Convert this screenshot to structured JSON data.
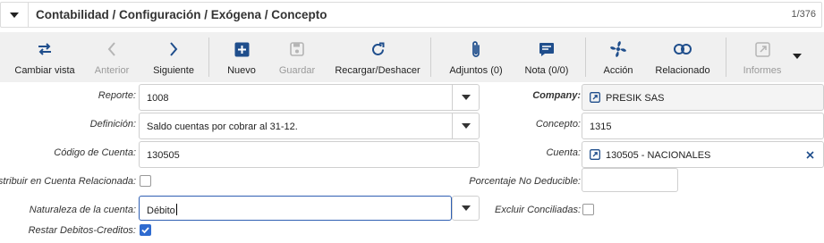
{
  "header": {
    "title": "Contabilidad / Configuración / Exógena / Concepto",
    "record_counter": "1/376"
  },
  "toolbar": {
    "buttons": [
      {
        "label": "Cambiar vista",
        "icon": "switch-view-icon",
        "enabled": true
      },
      {
        "label": "Anterior",
        "icon": "chevron-left-icon",
        "enabled": false
      },
      {
        "label": "Siguiente",
        "icon": "chevron-right-icon",
        "enabled": true
      },
      {
        "label": "Nuevo",
        "icon": "plus-square-icon",
        "enabled": true
      },
      {
        "label": "Guardar",
        "icon": "save-icon",
        "enabled": false
      },
      {
        "label": "Recargar/Deshacer",
        "icon": "reload-icon",
        "enabled": true
      },
      {
        "label": "Adjuntos (0)",
        "icon": "paperclip-icon",
        "enabled": true
      },
      {
        "label": "Nota (0/0)",
        "icon": "note-icon",
        "enabled": true
      },
      {
        "label": "Acción",
        "icon": "action-fan-icon",
        "enabled": true
      },
      {
        "label": "Relacionado",
        "icon": "link-icon",
        "enabled": true
      },
      {
        "label": "Informes",
        "icon": "external-report-icon",
        "enabled": false
      }
    ],
    "accent_color": "#1f4e8c"
  },
  "form": {
    "reporte": {
      "label": "Reporte:",
      "value": "1008"
    },
    "definicion": {
      "label": "Definición:",
      "value": "Saldo cuentas por cobrar al 31-12."
    },
    "codigo_cuenta": {
      "label": "Código de Cuenta:",
      "value": "130505"
    },
    "distribuir": {
      "label": "Distribuir en Cuenta Relacionada:",
      "checked": false
    },
    "naturaleza": {
      "label": "Naturaleza  de la cuenta:",
      "value": "Débito"
    },
    "restar": {
      "label": "Restar Debitos-Creditos:",
      "checked": true
    },
    "company": {
      "label": "Company:",
      "value": "PRESIK SAS"
    },
    "concepto": {
      "label": "Concepto:",
      "value": "1315"
    },
    "cuenta": {
      "label": "Cuenta:",
      "value": "130505 - NACIONALES"
    },
    "porcentaje": {
      "label": "Porcentaje No Deducible:",
      "value": ""
    },
    "excluir": {
      "label": "Excluir Conciliadas:",
      "checked": false
    }
  }
}
